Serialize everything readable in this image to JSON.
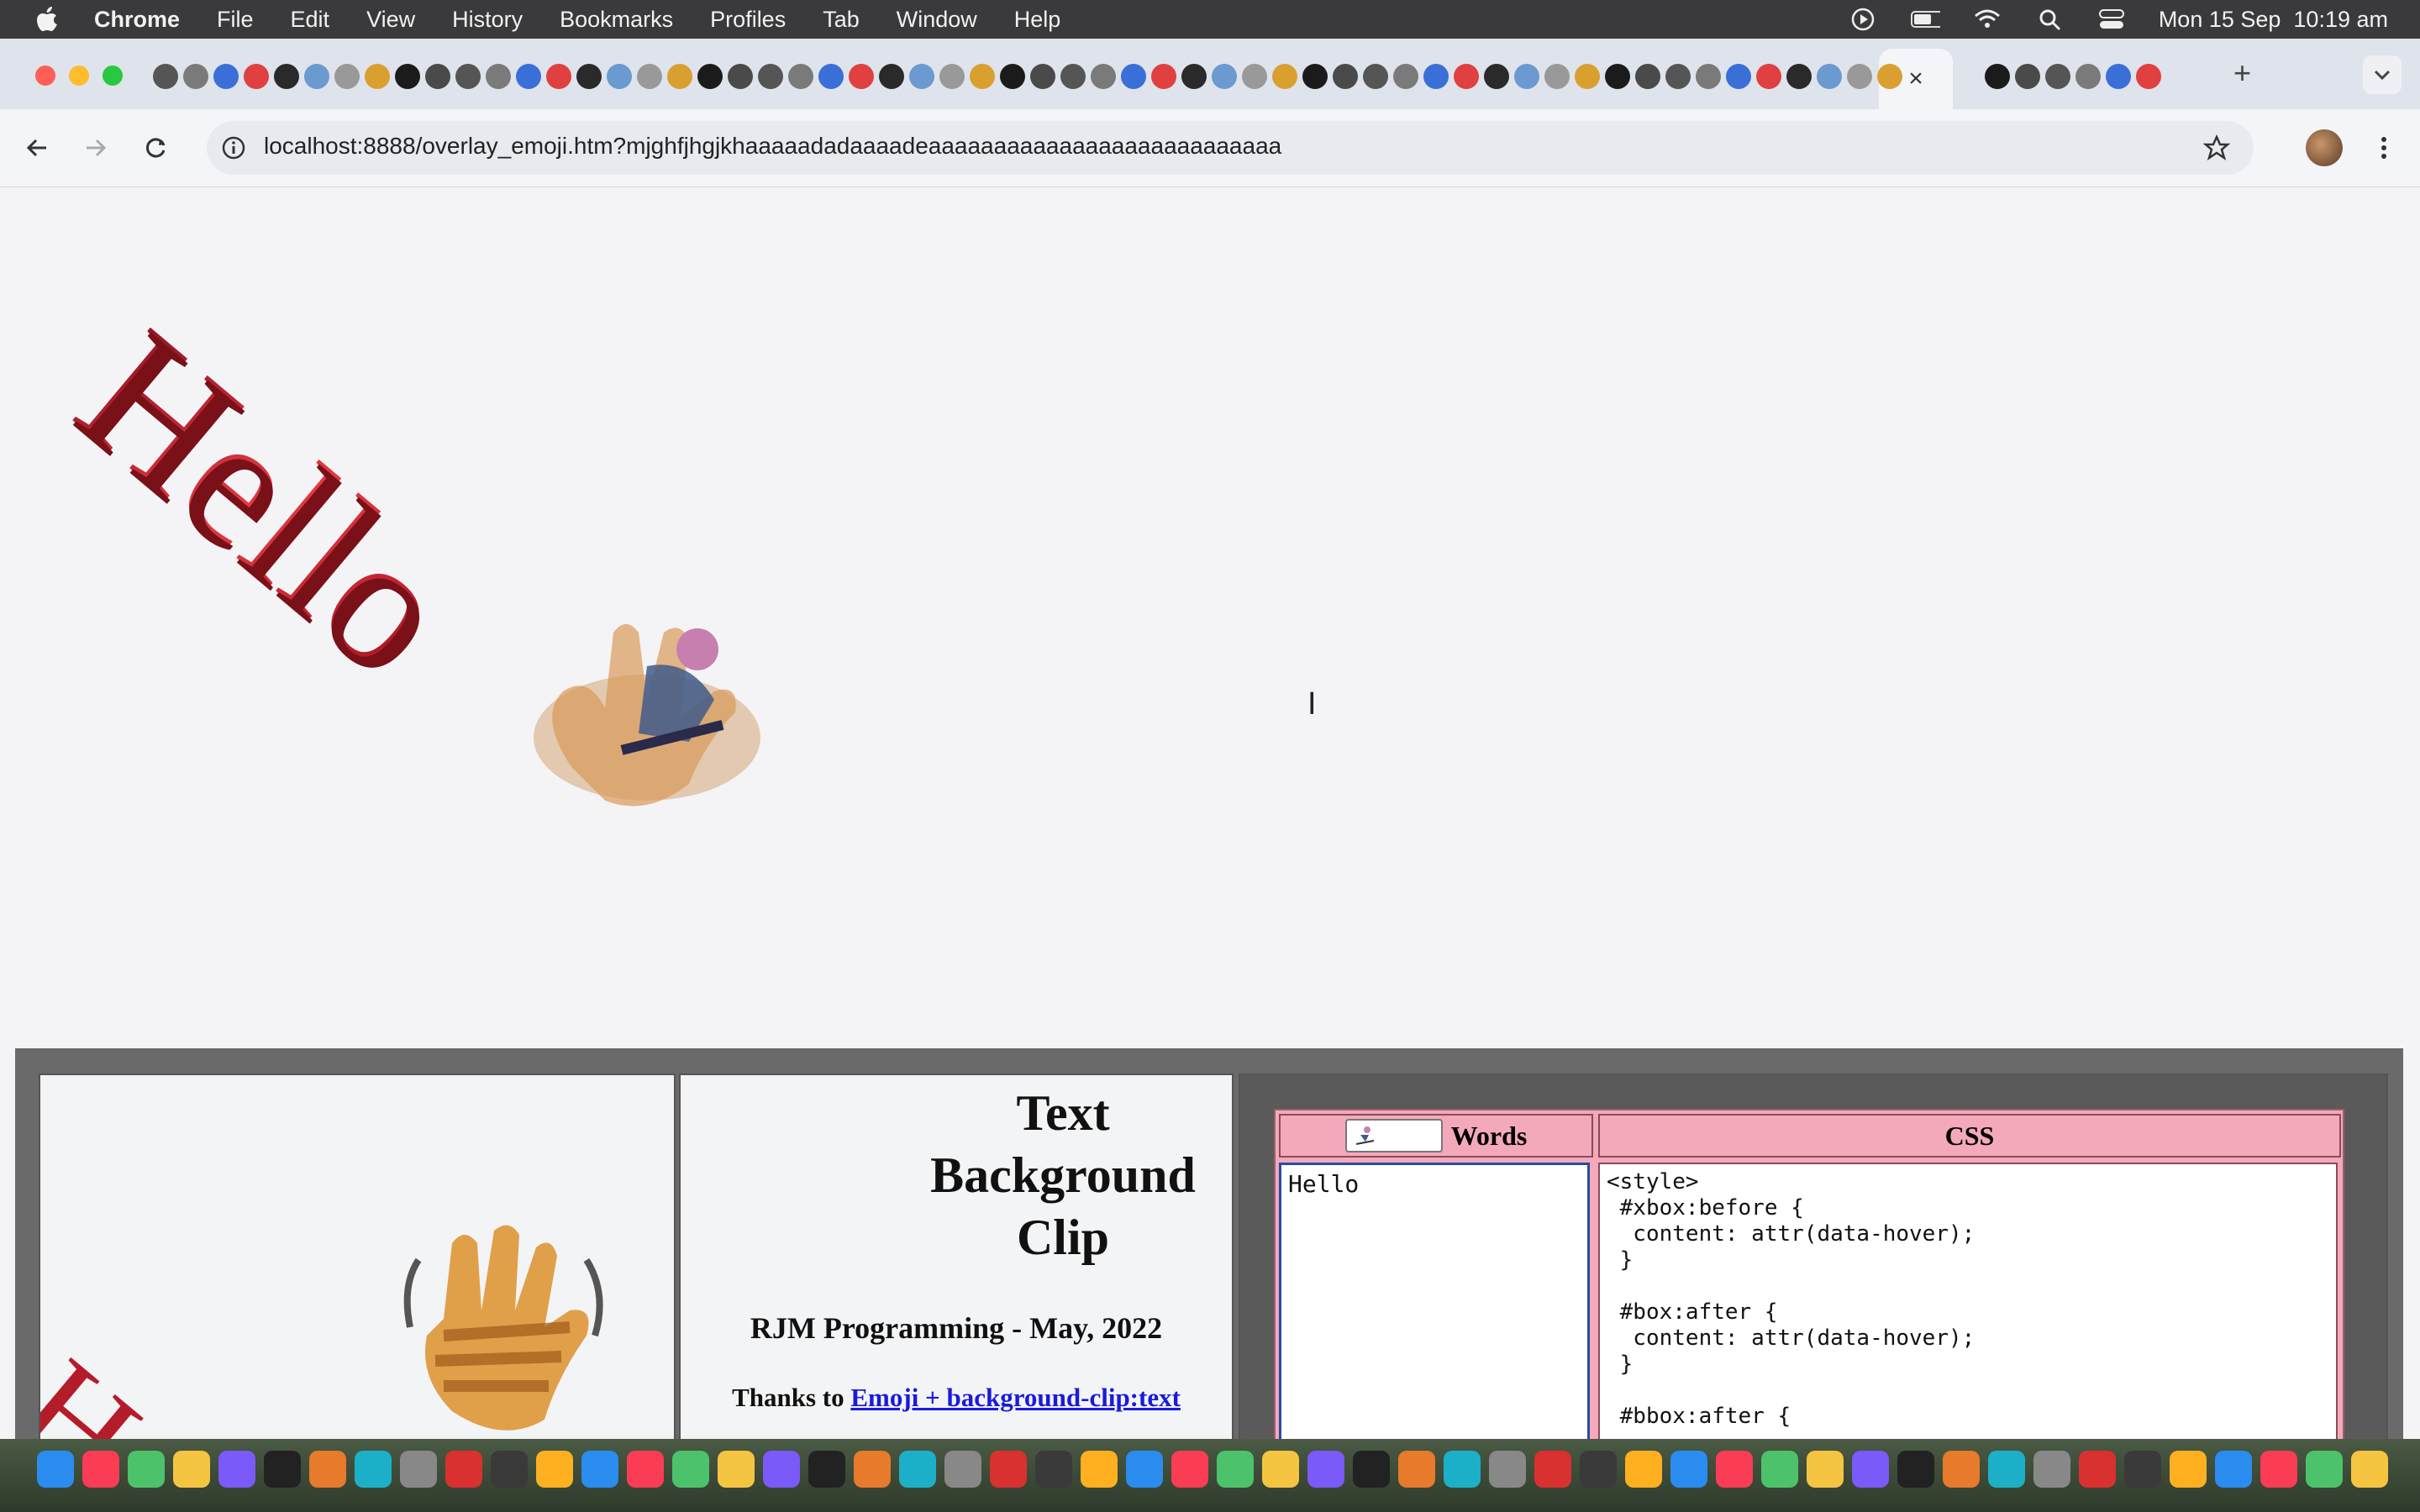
{
  "menubar": {
    "app": "Chrome",
    "items": [
      "File",
      "Edit",
      "View",
      "History",
      "Bookmarks",
      "Profiles",
      "Tab",
      "Window",
      "Help"
    ],
    "clock": "Mon 15 Sep  10:19 am"
  },
  "tabs": {
    "active_close": "×",
    "new_tab": "+"
  },
  "toolbar": {
    "url": "localhost:8888/overlay_emoji.htm?mjghfjhgjkhaaaaadadaaaadeaaaaaaaaaaaaaaaaaaaaaaaaaaa"
  },
  "page": {
    "hello_big": "Hello",
    "hello_small": "H",
    "title": "Text Background Clip",
    "byline": "RJM Programming - May, 2022",
    "thanks_prefix": "Thanks to",
    "thanks_link": "Emoji + background-clip:text",
    "words_header": "Words",
    "css_header": "CSS",
    "words_value": "Hello",
    "css_value": "<style>\n #xbox:before {\n  content: attr(data-hover);\n }\n\n #box:after {\n  content: attr(data-hover);\n }\n\n #bbox:after {"
  },
  "colors": {
    "menubar_bg": "#3a3a3c",
    "hello_red": "#c21f30",
    "table_pink": "#f4a9bb",
    "link_blue": "#1a1adb"
  }
}
